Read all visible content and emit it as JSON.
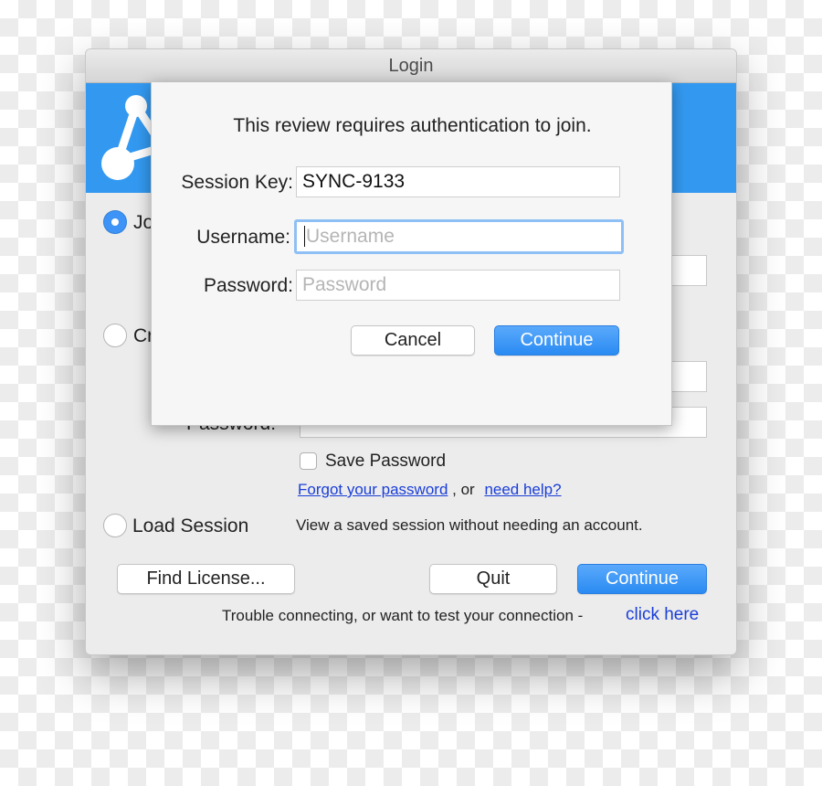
{
  "window": {
    "title": "Login"
  },
  "main": {
    "join_label": "Join",
    "create_label": "Create",
    "password_label": "Password:",
    "save_password": "Save Password",
    "forgot_link": "Forgot your password",
    "or_text": ", or",
    "help_link": "need help?",
    "load_session": "Load Session",
    "load_desc": "View a saved session without needing an account.",
    "find_license": "Find License...",
    "quit": "Quit",
    "continue": "Continue",
    "trouble_text": "Trouble connecting, or want to test your connection -",
    "click_here": "click here"
  },
  "sheet": {
    "message": "This review requires authentication to join.",
    "session_key_label": "Session Key:",
    "session_key_value": "SYNC-9133",
    "username_label": "Username:",
    "username_placeholder": "Username",
    "password_label": "Password:",
    "password_placeholder": "Password",
    "cancel": "Cancel",
    "continue": "Continue"
  },
  "colors": {
    "accent": "#3399f0",
    "link": "#1a3ed8"
  }
}
